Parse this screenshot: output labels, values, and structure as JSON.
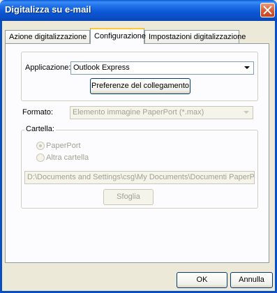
{
  "window": {
    "title": "Digitalizza su e-mail"
  },
  "tabs": [
    {
      "label": "Azione digitalizzazione",
      "active": false
    },
    {
      "label": "Configurazione",
      "active": true
    },
    {
      "label": "Impostazioni digitalizzazione",
      "active": false
    }
  ],
  "application": {
    "label": "Applicazione:",
    "value": "Outlook Express",
    "link_button": "Preferenze del collegamento"
  },
  "format": {
    "label": "Formato:",
    "value": "Elemento immagine PaperPort (*.max)",
    "enabled": false
  },
  "folder": {
    "group_label": "Cartella:",
    "options": [
      {
        "label": "PaperPort",
        "selected": true
      },
      {
        "label": "Altra cartella",
        "selected": false
      }
    ],
    "path": "D:\\Documents and Settings\\csg\\My Documents\\Documenti PaperPort",
    "browse_button": "Sfoglia",
    "enabled": false
  },
  "footer": {
    "ok_label": "OK",
    "cancel_label": "Annulla"
  }
}
